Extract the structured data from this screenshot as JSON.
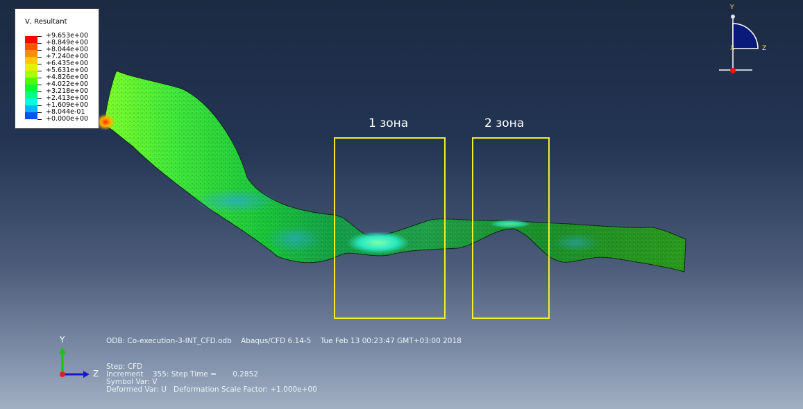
{
  "legend": {
    "title": "V, Resultant",
    "levels": [
      {
        "label": "+9.653e+00",
        "color": "#ff0000"
      },
      {
        "label": "+8.849e+00",
        "color": "#ff5300"
      },
      {
        "label": "+8.044e+00",
        "color": "#ff8f00"
      },
      {
        "label": "+7.240e+00",
        "color": "#ffc800"
      },
      {
        "label": "+6.435e+00",
        "color": "#e6f000"
      },
      {
        "label": "+5.631e+00",
        "color": "#a8ff00"
      },
      {
        "label": "+4.826e+00",
        "color": "#4cff00"
      },
      {
        "label": "+4.022e+00",
        "color": "#00ff2f"
      },
      {
        "label": "+3.218e+00",
        "color": "#00ff8c"
      },
      {
        "label": "+2.413e+00",
        "color": "#00ffe0"
      },
      {
        "label": "+1.609e+00",
        "color": "#00b8ff"
      },
      {
        "label": "+8.044e-01",
        "color": "#0052ff"
      },
      {
        "label": "+0.000e+00",
        "color": "#0000ff"
      }
    ]
  },
  "zones": [
    {
      "label": "1 зона"
    },
    {
      "label": "2 зона"
    }
  ],
  "info": {
    "odb_line": "ODB: Co-execution-3-INT_CFD.odb    Abaqus/CFD 6.14-5    Tue Feb 13 00:23:47 GMT+03:00 2018",
    "step": "Step: CFD",
    "increment": "Increment    355: Step Time =       0.2852",
    "symbol_var": "Symbol Var: V",
    "deformed_var": "Deformed Var: U   Deformation Scale Factor: +1.000e+00"
  },
  "triad": {
    "y_label": "Y",
    "z_label": "Z"
  },
  "view_cube": {
    "y_label": "Y",
    "z_label": "Z",
    "x_label": "X"
  },
  "colors": {
    "zone_outline": "#f2ee2a",
    "background_top": "#1c2a42",
    "background_bottom": "#a2afc3"
  }
}
